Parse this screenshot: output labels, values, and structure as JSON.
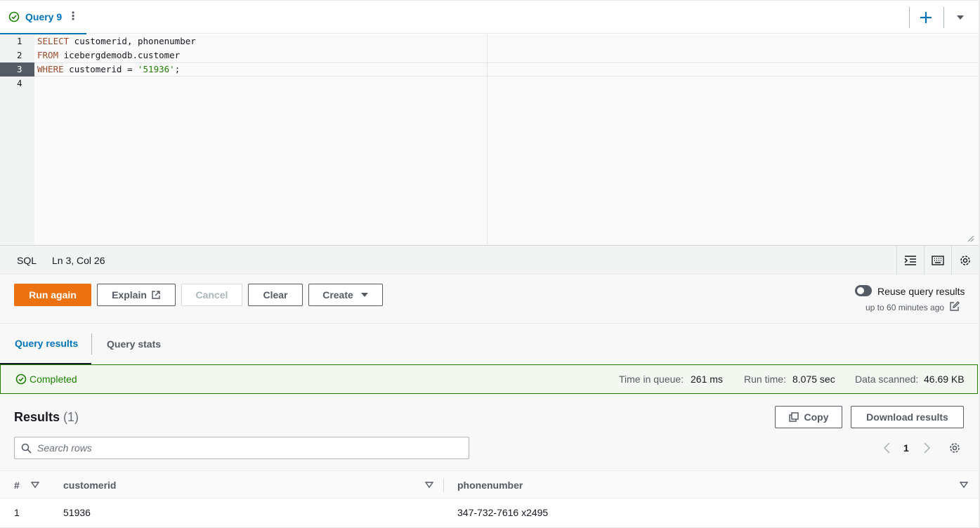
{
  "tab": {
    "title": "Query 9"
  },
  "editor": {
    "line_numbers": [
      "1",
      "2",
      "3",
      "4"
    ],
    "lines": [
      {
        "kw": "SELECT",
        "rest": " customerid, phonenumber"
      },
      {
        "kw": "FROM",
        "rest": " icebergdemodb.customer"
      },
      {
        "kw": "WHERE",
        "rest": " customerid = ",
        "str": "'51936'",
        "tail": ";"
      }
    ]
  },
  "status": {
    "language": "SQL",
    "position": "Ln 3, Col 26"
  },
  "actions": {
    "run": "Run again",
    "explain": "Explain",
    "cancel": "Cancel",
    "clear": "Clear",
    "create": "Create",
    "reuse_label": "Reuse query results",
    "reuse_sub": "up to 60 minutes ago"
  },
  "result_tabs": {
    "results": "Query results",
    "stats": "Query stats"
  },
  "banner": {
    "status": "Completed",
    "queue_label": "Time in queue:",
    "queue_value": "261 ms",
    "run_label": "Run time:",
    "run_value": "8.075 sec",
    "scan_label": "Data scanned:",
    "scan_value": "46.69 KB"
  },
  "results": {
    "title": "Results",
    "count": "(1)",
    "copy": "Copy",
    "download": "Download results",
    "search_placeholder": "Search rows",
    "page": "1",
    "columns": [
      "#",
      "customerid",
      "phonenumber"
    ],
    "rows": [
      [
        "1",
        "51936",
        "347-732-7616 x2495"
      ]
    ]
  },
  "colors": {
    "accent": "#0073bb",
    "primary_button": "#ec7211",
    "success": "#1d8102"
  }
}
